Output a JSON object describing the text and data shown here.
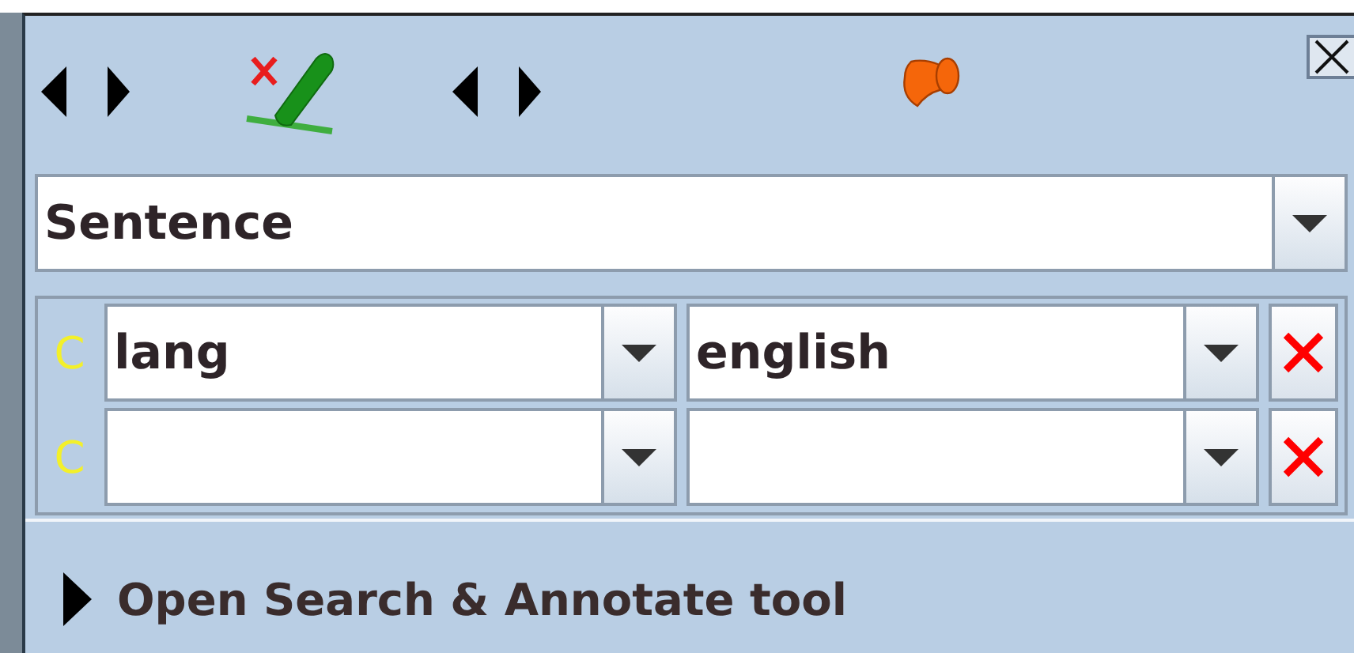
{
  "layer_combo": {
    "value": "Sentence"
  },
  "constraints": [
    {
      "marker": "C",
      "feature": "lang",
      "value": "english"
    },
    {
      "marker": "C"
    }
  ],
  "expander": {
    "label": "Open Search & Annotate tool",
    "expanded": false
  }
}
